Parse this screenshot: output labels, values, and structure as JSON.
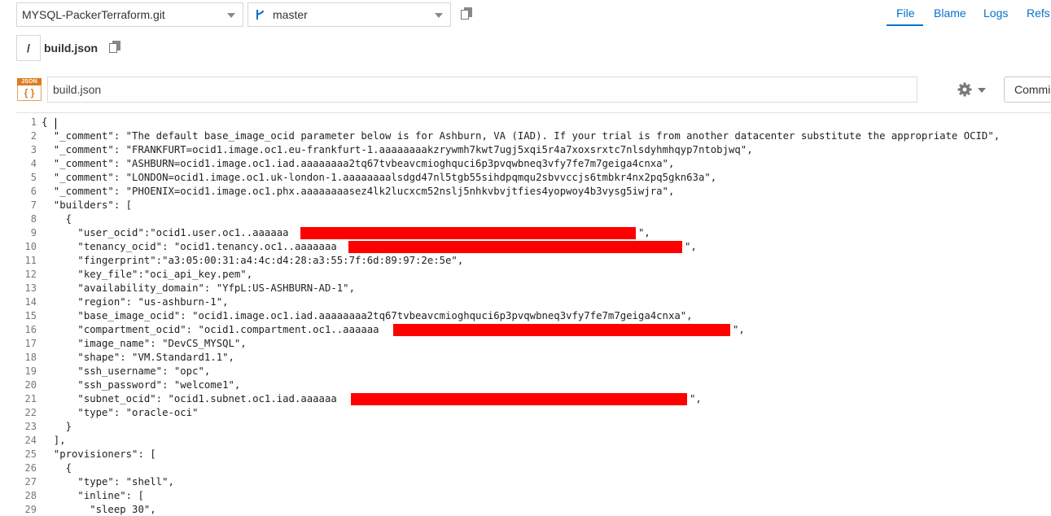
{
  "header": {
    "repo_select": "MYSQL-PackerTerraform.git",
    "branch_select": "master",
    "tabs": [
      "File",
      "Blame",
      "Logs",
      "Refs"
    ],
    "active_tab": "File"
  },
  "breadcrumb": {
    "root": "/",
    "file": "build.json"
  },
  "toolbar": {
    "badge_top": "JSON",
    "badge_bottom": "{ }",
    "path_value": "build.json",
    "commit_label": "Commi"
  },
  "editor": {
    "lines": [
      "{",
      "  \"_comment\": \"The default base_image_ocid parameter below is for Ashburn, VA (IAD). If your trial is from another datacenter substitute the appropriate OCID\",",
      "  \"_comment\": \"FRANKFURT=ocid1.image.oc1.eu-frankfurt-1.aaaaaaaakzrywmh7kwt7ugj5xqi5r4a7xoxsrxtc7nlsdyhmhqyp7ntobjwq\",",
      "  \"_comment\": \"ASHBURN=ocid1.image.oc1.iad.aaaaaaaa2tq67tvbeavcmioghquci6p3pvqwbneq3vfy7fe7m7geiga4cnxa\",",
      "  \"_comment\": \"LONDON=ocid1.image.oc1.uk-london-1.aaaaaaaalsdgd47nl5tgb55sihdpqmqu2sbvvccjs6tmbkr4nx2pq5gkn63a\",",
      "  \"_comment\": \"PHOENIX=ocid1.image.oc1.phx.aaaaaaaasez4lk2lucxcm52nslj5nhkvbvjtfies4yopwoy4b3vysg5iwjra\",",
      "  \"builders\": [",
      "    {",
      "      \"user_ocid\":\"ocid1.user.oc1..aaaaaa",
      "      \"tenancy_ocid\": \"ocid1.tenancy.oc1..aaaaaaa",
      "      \"fingerprint\":\"a3:05:00:31:a4:4c:d4:28:a3:55:7f:6d:89:97:2e:5e\",",
      "      \"key_file\":\"oci_api_key.pem\",",
      "      \"availability_domain\": \"YfpL:US-ASHBURN-AD-1\",",
      "      \"region\": \"us-ashburn-1\",",
      "      \"base_image_ocid\": \"ocid1.image.oc1.iad.aaaaaaaa2tq67tvbeavcmioghquci6p3pvqwbneq3vfy7fe7m7geiga4cnxa\",",
      "      \"compartment_ocid\": \"ocid1.compartment.oc1..aaaaaa",
      "      \"image_name\": \"DevCS_MYSQL\",",
      "      \"shape\": \"VM.Standard1.1\",",
      "      \"ssh_username\": \"opc\",",
      "      \"ssh_password\": \"welcome1\",",
      "      \"subnet_ocid\": \"ocid1.subnet.oc1.iad.aaaaaa",
      "      \"type\": \"oracle-oci\"",
      "    }",
      "  ],",
      "  \"provisioners\": [",
      "    {",
      "      \"type\": \"shell\",",
      "      \"inline\": [",
      "        \"sleep 30\","
    ],
    "line_tails": {
      "9": "\",",
      "10": "\",",
      "16": "\",",
      "21": "\","
    }
  }
}
